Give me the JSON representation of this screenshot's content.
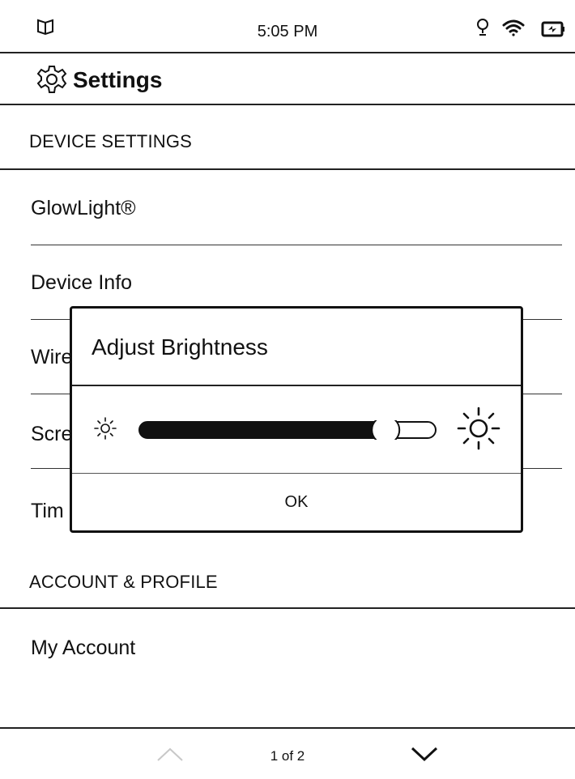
{
  "status_bar": {
    "time": "5:05 PM",
    "icons": [
      "book-icon",
      "lightbulb-icon",
      "wifi-icon",
      "battery-charging-icon"
    ]
  },
  "header": {
    "title": "Settings",
    "icon": "gear-icon"
  },
  "sections": [
    {
      "title": "DEVICE SETTINGS",
      "items": [
        "GlowLight®",
        "Device Info",
        "Wire",
        "Scre",
        "Tim"
      ]
    },
    {
      "title": "ACCOUNT & PROFILE",
      "items": [
        "My Account"
      ]
    }
  ],
  "dialog": {
    "title": "Adjust Brightness",
    "brightness_level": 0.86,
    "ok_label": "OK",
    "icons": [
      "sun-small-icon",
      "sun-large-icon"
    ]
  },
  "pagination": {
    "label": "1 of 2"
  }
}
